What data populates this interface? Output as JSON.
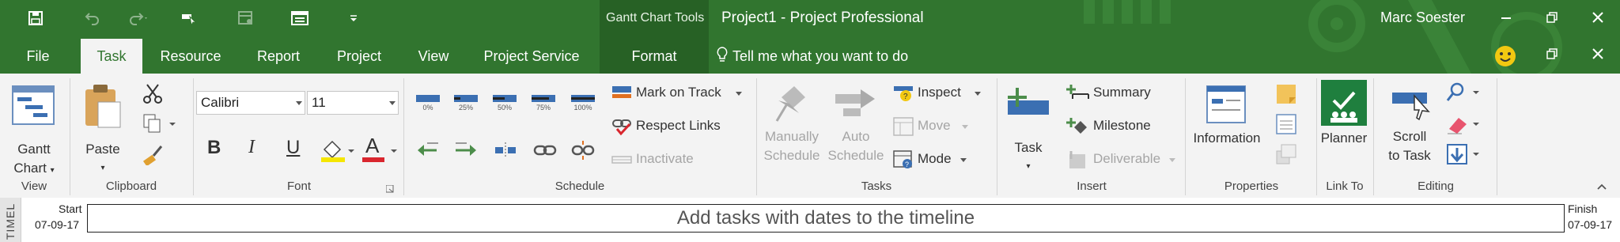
{
  "title_bar": {
    "context_tab_group": "Gantt Chart Tools",
    "document_title": "Project1  -  Project Professional",
    "user_name": "Marc Soester"
  },
  "tabs": [
    {
      "label": "File"
    },
    {
      "label": "Task"
    },
    {
      "label": "Resource"
    },
    {
      "label": "Report"
    },
    {
      "label": "Project"
    },
    {
      "label": "View"
    },
    {
      "label": "Project Service"
    },
    {
      "label": "Format"
    }
  ],
  "tell_me": "Tell me what you want to do",
  "ribbon": {
    "view": {
      "gantt_label_1": "Gantt",
      "gantt_label_2": "Chart",
      "group": "View"
    },
    "clipboard": {
      "paste": "Paste",
      "group": "Clipboard"
    },
    "font": {
      "font_name": "Calibri",
      "font_size": "11",
      "bold": "B",
      "italic": "I",
      "underline": "U",
      "font_color_letter": "A",
      "group": "Font"
    },
    "schedule": {
      "percents": [
        "0%",
        "25%",
        "50%",
        "75%",
        "100%"
      ],
      "mark_on_track": "Mark on Track",
      "respect_links": "Respect Links",
      "inactivate": "Inactivate",
      "group": "Schedule"
    },
    "tasks": {
      "manually_1": "Manually",
      "manually_2": "Schedule",
      "auto_1": "Auto",
      "auto_2": "Schedule",
      "inspect": "Inspect",
      "move": "Move",
      "mode": "Mode",
      "group": "Tasks"
    },
    "insert": {
      "task": "Task",
      "summary": "Summary",
      "milestone": "Milestone",
      "deliverable": "Deliverable",
      "group": "Insert"
    },
    "properties": {
      "information": "Information",
      "group": "Properties"
    },
    "link_to": {
      "planner": "Planner",
      "group": "Link To"
    },
    "editing": {
      "scroll_1": "Scroll",
      "scroll_2": "to Task",
      "group": "Editing"
    }
  },
  "timeline": {
    "vertical_label": "TIMEL",
    "start_label": "Start",
    "start_date": "07-09-17",
    "finish_label": "Finish",
    "finish_date": "07-09-17",
    "placeholder": "Add tasks with dates to the timeline"
  },
  "colors": {
    "brand": "#31752f",
    "brand_dark": "#276125",
    "ribbon_bg": "#f3f3f3",
    "bar_blue": "#3b6fb2"
  }
}
